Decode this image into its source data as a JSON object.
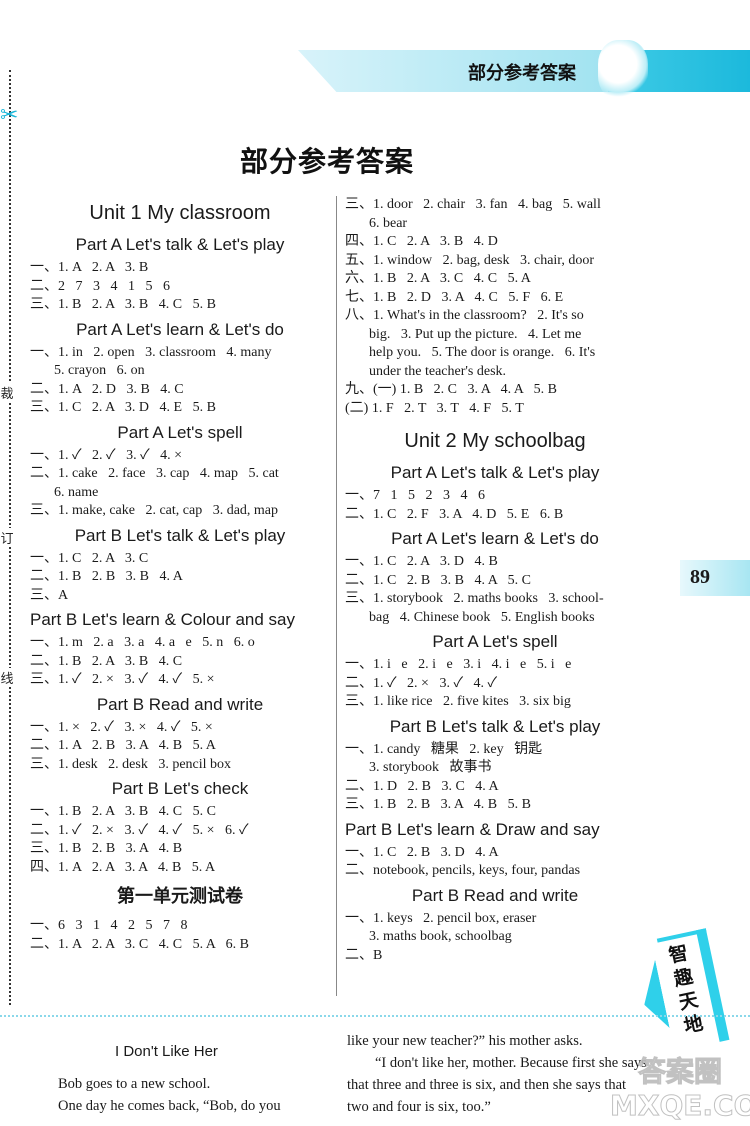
{
  "header": {
    "banner_title": "部分参考答案"
  },
  "page_title": "部分参考答案",
  "margin_marks": [
    "裁",
    "订",
    "线"
  ],
  "page_number": "89",
  "side_tag": "智趣天地",
  "left_column": {
    "unit_title": "Unit 1   My classroom",
    "sections": [
      {
        "title": "Part A   Let's talk & Let's play",
        "lines": [
          "一、1. A   2. A   3. B",
          "二、2   7   3   4   1   5   6",
          "三、1. B   2. A   3. B   4. C   5. B"
        ]
      },
      {
        "title": "Part A   Let's learn & Let's do",
        "lines": [
          "一、1. in   2. open   3. classroom   4. many",
          "5. crayon   6. on",
          "二、1. A   2. D   3. B   4. C",
          "三、1. C   2. A   3. D   4. E   5. B"
        ]
      },
      {
        "title": "Part A   Let's spell",
        "lines": [
          "一、1. ✓   2. ✓   3. ✓   4. ×",
          "二、1. cake   2. face   3. cap   4. map   5. cat",
          "6. name",
          "三、1. make, cake   2. cat, cap   3. dad, map"
        ]
      },
      {
        "title": "Part B   Let's talk & Let's play",
        "lines": [
          "一、1. C   2. A   3. C",
          "二、1. B   2. B   3. B   4. A",
          "三、A"
        ]
      },
      {
        "title": "Part B   Let's learn & Colour and say",
        "lines": [
          "一、1. m   2. a   3. a   4. a   e   5. n   6. o",
          "二、1. B   2. A   3. B   4. C",
          "三、1. ✓   2. ×   3. ✓   4. ✓   5. ×"
        ]
      },
      {
        "title": "Part B   Read and write",
        "lines": [
          "一、1. ×   2. ✓   3. ×   4. ✓   5. ×",
          "二、1. A   2. B   3. A   4. B   5. A",
          "三、1. desk   2. desk   3. pencil box"
        ]
      },
      {
        "title": "Part B   Let's check",
        "lines": [
          "一、1. B   2. A   3. B   4. C   5. C",
          "二、1. ✓   2. ×   3. ✓   4. ✓   5. ×   6. ✓",
          "三、1. B   2. B   3. A   4. B",
          "四、1. A   2. A   3. A   4. B   5. A"
        ]
      }
    ],
    "test_title": "第一单元测试卷",
    "test_lines": [
      "一、6   3   1   4   2   5   7   8",
      "二、1. A   2. A   3. C   4. C   5. A   6. B"
    ]
  },
  "right_column": {
    "test_continued": [
      "三、1. door   2. chair   3. fan   4. bag   5. wall",
      "6. bear",
      "四、1. C   2. A   3. B   4. D",
      "五、1. window   2. bag, desk   3. chair, door",
      "六、1. B   2. A   3. C   4. C   5. A",
      "七、1. B   2. D   3. A   4. C   5. F   6. E",
      "八、1. What's in the classroom?   2. It's so",
      "big.   3. Put up the picture.   4. Let me",
      "help you.   5. The door is orange.   6. It's",
      "under the teacher's desk.",
      "九、(一) 1. B   2. C   3. A   4. A   5. B",
      "(二) 1. F   2. T   3. T   4. F   5. T"
    ],
    "unit_title": "Unit 2   My schoolbag",
    "sections": [
      {
        "title": "Part A   Let's talk & Let's play",
        "lines": [
          "一、7   1   5   2   3   4   6",
          "二、1. C   2. F   3. A   4. D   5. E   6. B"
        ]
      },
      {
        "title": "Part A   Let's learn & Let's do",
        "lines": [
          "一、1. C   2. A   3. D   4. B",
          "二、1. C   2. B   3. B   4. A   5. C",
          "三、1. storybook   2. maths books   3. school-",
          "bag   4. Chinese book   5. English books"
        ]
      },
      {
        "title": "Part A   Let's spell",
        "lines": [
          "一、1. i   e   2. i   e   3. i   4. i   e   5. i   e",
          "二、1. ✓   2. ×   3. ✓   4. ✓",
          "三、1. like rice   2. five kites   3. six big"
        ]
      },
      {
        "title": "Part B   Let's talk & Let's play",
        "lines": [
          "一、1. candy   糖果   2. key   钥匙",
          "3. storybook   故事书",
          "二、1. D   2. B   3. C   4. A",
          "三、1. B   2. B   3. A   4. B   5. B"
        ]
      },
      {
        "title": "Part B   Let's learn & Draw and say",
        "lines": [
          "一、1. C   2. B   3. D   4. A",
          "二、notebook, pencils, keys, four, pandas"
        ]
      },
      {
        "title": "Part B   Read and write",
        "lines": [
          "一、1. keys   2. pencil box, eraser",
          "3. maths book, schoolbag",
          "二、B"
        ]
      }
    ]
  },
  "story": {
    "title": "I Don't Like Her",
    "left_paragraphs": [
      "Bob goes to a new school.",
      "One day he comes back, “Bob, do you"
    ],
    "right_paragraphs": [
      "like your new teacher?” his mother asks.",
      "“I don't like her, mother. Because first she says that three and three is six, and then she says that two and four is six, too.”"
    ]
  },
  "watermark": "答案圈 MXQE.COM"
}
